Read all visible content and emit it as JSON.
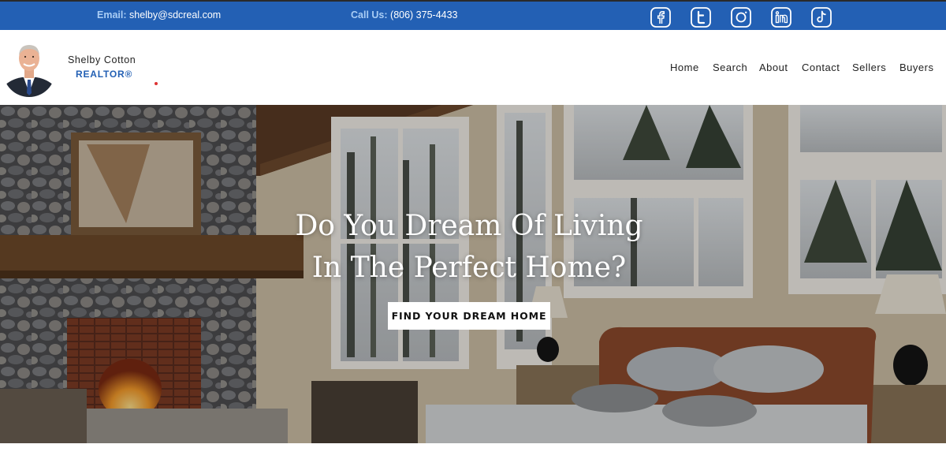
{
  "topbar": {
    "email_label": "Email:",
    "email_value": "shelby@sdcreal.com",
    "phone_label": "Call Us:",
    "phone_value": "(806) 375-4433",
    "color": "#2360b4",
    "social": [
      "facebook-icon",
      "twitter-icon",
      "instagram-icon",
      "linkedin-icon",
      "tiktok-icon"
    ]
  },
  "brand": {
    "name": "Shelby Cotton",
    "title": "REALTOR®"
  },
  "nav": {
    "items": [
      {
        "label": "Home"
      },
      {
        "label": "Search"
      },
      {
        "label": "About"
      },
      {
        "label": "Contact"
      },
      {
        "label": "Sellers"
      },
      {
        "label": "Buyers"
      }
    ]
  },
  "hero": {
    "headline_line1": "Do You Dream Of Living",
    "headline_line2": "In The Perfect Home?",
    "cta_label": "FIND YOUR DREAM HOME"
  }
}
